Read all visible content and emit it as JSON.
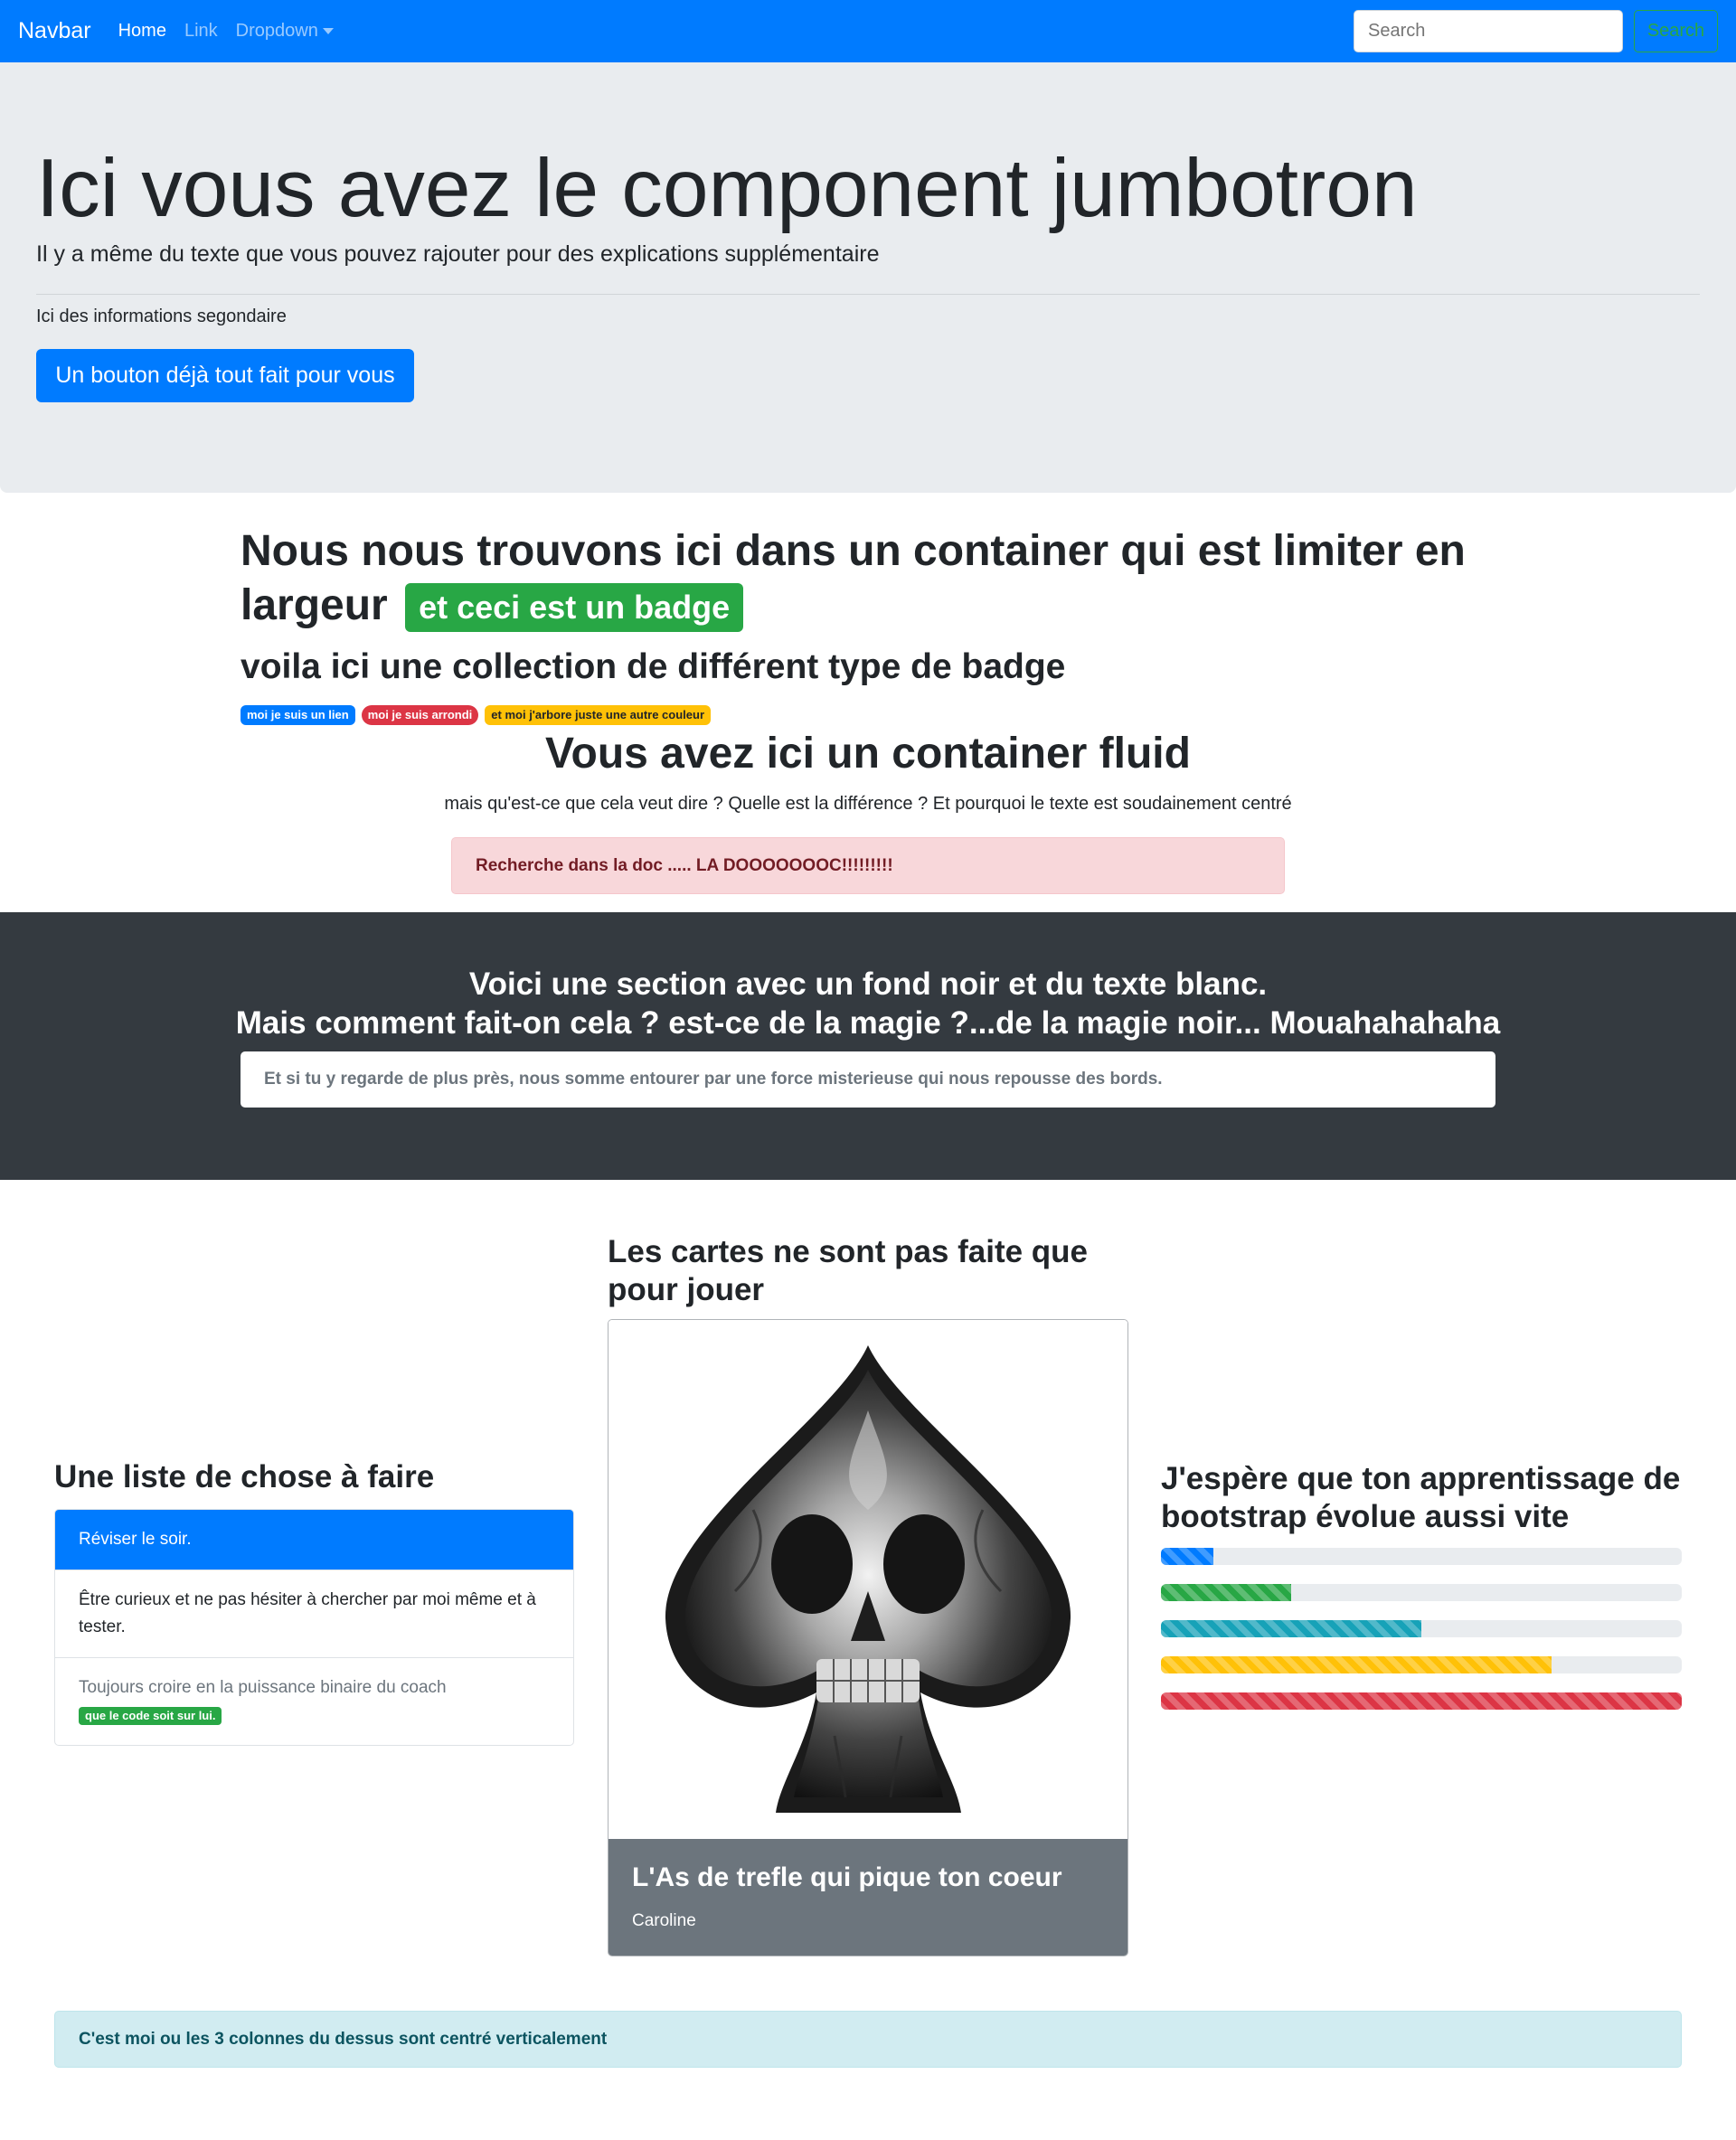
{
  "navbar": {
    "brand": "Navbar",
    "links": [
      "Home",
      "Link",
      "Dropdown"
    ],
    "search_placeholder": "Search",
    "search_button": "Search",
    "colors": {
      "background": "#007bff",
      "search_button": "#28a745"
    }
  },
  "jumbotron": {
    "title": "Ici vous avez le component jumbotron",
    "lead": "Il y a même du texte que vous pouvez rajouter pour des explications supplémentaire",
    "secondary": "Ici des informations segondaire",
    "button": "Un bouton déjà tout fait pour vous"
  },
  "container": {
    "title": "Nous nous trouvons ici dans un container qui est limiter en largeur",
    "title_badge": "et ceci est un badge",
    "subtitle": "voila ici une collection de différent type de badge",
    "badges": [
      "moi je suis un lien",
      "moi je suis arrondi",
      "et moi j'arbore juste une autre couleur"
    ]
  },
  "fluid": {
    "title": "Vous avez ici un container fluid",
    "text": "mais qu'est-ce que cela veut dire ? Quelle est la différence ? Et pourquoi le texte est soudainement centré",
    "alert": "Recherche dans la doc ..... LA DOOOOOOOC!!!!!!!!!"
  },
  "dark_section": {
    "line1": "Voici une section avec un fond noir et du texte blanc.",
    "line2": "Mais comment fait-on cela ? est-ce de la magie ?...de la magie noir... Mouahahahaha",
    "box": "Et si tu y regarde de plus près, nous somme entourer par une force misterieuse qui nous repousse des bords."
  },
  "todo": {
    "title": "Une liste de chose à faire",
    "items": [
      "Réviser le soir.",
      "Être curieux et ne pas hésiter à chercher par moi même et à tester.",
      "Toujours croire en la puissance binaire du coach"
    ],
    "item_badge": "que le code soit sur lui."
  },
  "card_section": {
    "title": "Les cartes ne sont pas faite que pour jouer",
    "card_title": "L'As de trefle qui pique ton coeur",
    "card_text": "Caroline",
    "image_icon": "spade-skull-icon"
  },
  "progress_section": {
    "title": "J'espère que ton apprentissage de bootstrap évolue aussi vite",
    "bars": [
      {
        "value": 10,
        "color": "#007bff"
      },
      {
        "value": 25,
        "color": "#28a745"
      },
      {
        "value": 50,
        "color": "#17a2b8"
      },
      {
        "value": 75,
        "color": "#ffc107"
      },
      {
        "value": 100,
        "color": "#dc3545"
      }
    ]
  },
  "footer_alert": "C'est moi ou les 3 colonnes du dessus sont centré verticalement"
}
